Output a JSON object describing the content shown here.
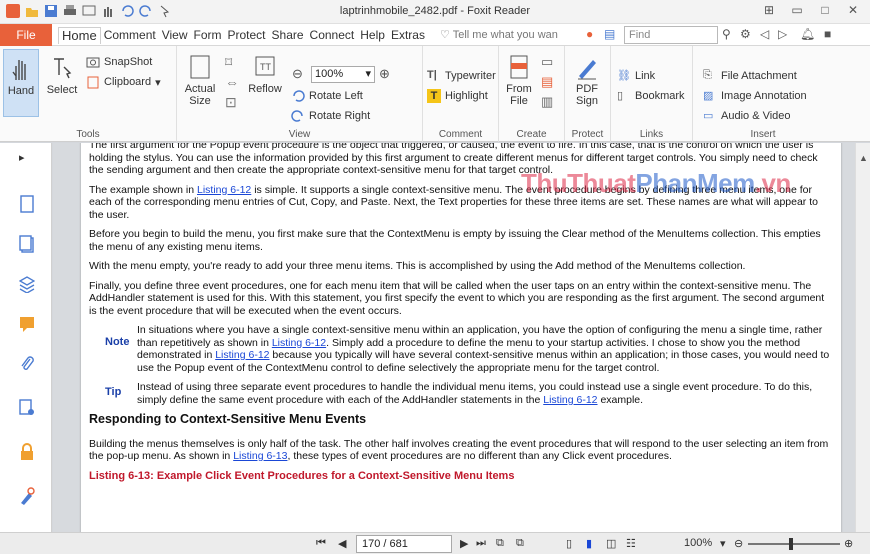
{
  "window": {
    "title": "laptrinhmobile_2482.pdf - Foxit Reader"
  },
  "menubar": {
    "file": "File",
    "items": [
      "Home",
      "Comment",
      "View",
      "Form",
      "Protect",
      "Share",
      "Connect",
      "Help",
      "Extras"
    ],
    "active": "Home",
    "tellme_placeholder": "Tell me what you wan",
    "find_placeholder": "Find"
  },
  "ribbon": {
    "tools": {
      "label": "Tools",
      "hand": "Hand",
      "select": "Select",
      "snapshot": "SnapShot",
      "clipboard": "Clipboard"
    },
    "view": {
      "label": "View",
      "actual_size_1": "Actual",
      "actual_size_2": "Size",
      "reflow": "Reflow",
      "zoom_value": "100%",
      "rotate_left": "Rotate Left",
      "rotate_right": "Rotate Right"
    },
    "comment": {
      "label": "Comment",
      "typewriter": "Typewriter",
      "highlight": "Highlight"
    },
    "create": {
      "label": "Create",
      "from_file_1": "From",
      "from_file_2": "File"
    },
    "protect": {
      "label": "Protect",
      "pdf_sign_1": "PDF",
      "pdf_sign_2": "Sign"
    },
    "links": {
      "label": "Links",
      "link": "Link",
      "bookmark": "Bookmark"
    },
    "insert": {
      "label": "Insert",
      "file_attachment": "File Attachment",
      "image_annotation": "Image Annotation",
      "audio_video": "Audio & Video"
    }
  },
  "document": {
    "p0": "The first argument for the Popup event procedure is the object that triggered, or caused, the event to fire. In this case, that is the control on which the user is holding the stylus. You can use the information provided by this first argument to create different menus for different target controls. You simply need to check the sending argument and then create the appropriate context-sensitive menu for that target control.",
    "p1_pre": "The example shown in ",
    "link_612": "Listing 6-12",
    "link_613": "Listing 6-13",
    "p1_post": " is simple. It supports a single context-sensitive menu. The event procedure begins by defining three menu items, one for each of the corresponding menu entries of Cut, Copy, and Paste. Next, the Text properties for these three items are set. These names are what will appear to the user.",
    "p2": "Before you begin to build the menu, you first make sure that the ContextMenu is empty by issuing the Clear method of the MenuItems collection. This empties the menu of any existing menu items.",
    "p3": "With the menu empty, you're ready to add your three menu items. This is accomplished by using the Add method of the MenuItems collection.",
    "p4": "Finally, you define three event procedures, one for each menu item that will be called when the user taps on an entry within the context-sensitive menu. The AddHandler statement is used for this. With this statement, you first specify the event to which you are responding as the first argument. The second argument is the event procedure that will be executed when the event occurs.",
    "note_label": "Note",
    "note_pre": "In situations where you have a single context-sensitive menu within an application, you have the option of configuring the menu a single time, rather than repetitively as shown in ",
    "note_mid1": ". Simply add a procedure to define the menu to your startup activities. I chose to show you the method demonstrated in ",
    "note_mid2": " because you typically will have several context-sensitive menus within an application; in those cases, you would need to use the Popup event of the ContextMenu control to define selectively the appropriate menu for the target control.",
    "tip_label": "Tip",
    "tip_pre": "Instead of using three separate event procedures to handle the individual menu items, you could instead use a single event procedure. To do this, simply define the same event procedure with each of the AddHandler statements in the ",
    "tip_post": " example.",
    "heading": "Responding to Context-Sensitive Menu Events",
    "p5_pre": "Building the menus themselves is only half of the task. The other half involves creating the event procedures that will respond to the user selecting an item from the pop-up menu. As shown in ",
    "p5_post": ", these types of event procedures are no different than any Click event procedures.",
    "listing_title": "Listing 6-13: Example Click Event Procedures for a Context-Sensitive Menu Items",
    "watermark_a": "ThuThuat",
    "watermark_b": "PhanMem",
    "watermark_c": ".vn"
  },
  "statusbar": {
    "page_value": "170 / 681",
    "zoom": "100%"
  },
  "colors": {
    "accent": "#e8613a",
    "link": "#1a47d6",
    "note": "#1a3fa8",
    "listing": "#c0182b"
  }
}
